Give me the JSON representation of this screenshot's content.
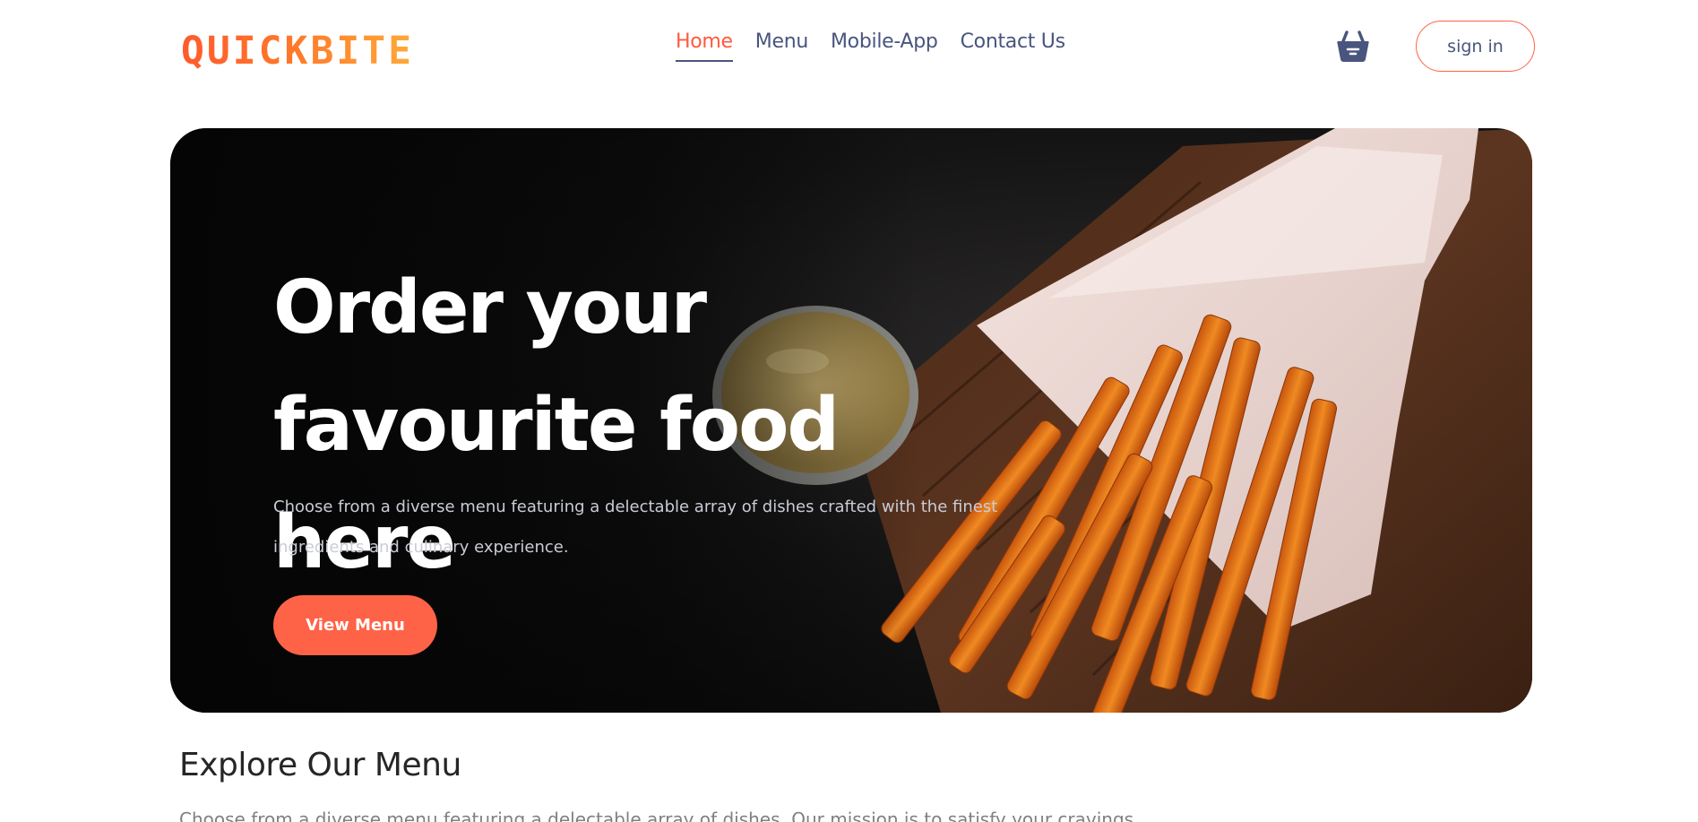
{
  "brand": {
    "logo_text": "QUICKBITE"
  },
  "nav": {
    "links": [
      {
        "label": "Home",
        "active": true
      },
      {
        "label": "Menu",
        "active": false
      },
      {
        "label": "Mobile-App",
        "active": false
      },
      {
        "label": "Contact Us",
        "active": false
      }
    ],
    "basket_icon": "basket-icon",
    "signin_label": "sign in"
  },
  "hero": {
    "title_line1": "Order your",
    "title_line2": "favourite food here",
    "description": "Choose from a diverse menu featuring a delectable array of dishes crafted with the finest ingredients and culinary experience.",
    "button_label": "View Menu"
  },
  "explore": {
    "title": "Explore Our Menu",
    "description": "Choose from a diverse menu featuring a delectable array of dishes. Our mission is to satisfy your cravings"
  },
  "colors": {
    "accent": "#ff6347",
    "nav_text": "#49557e",
    "active_nav": "#ff5a3c"
  }
}
